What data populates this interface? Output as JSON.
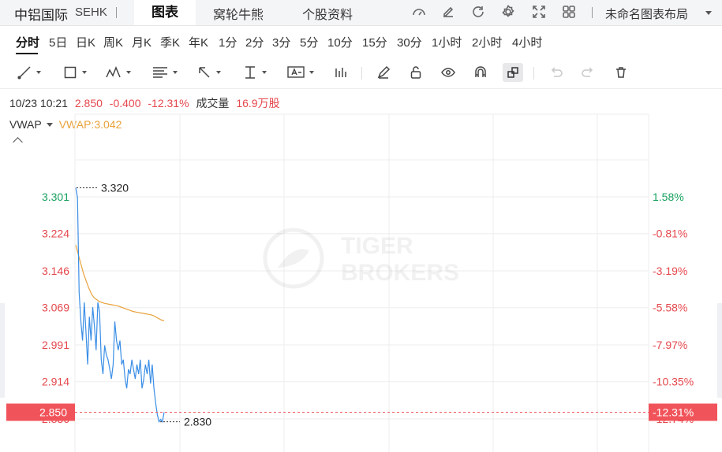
{
  "header": {
    "stock_name": "中铝国际",
    "exchange": "SEHK",
    "active_tab": "图表",
    "tabs": [
      "窝轮牛熊",
      "个股资料"
    ],
    "layout_name": "未命名图表布局"
  },
  "periods": [
    "分时",
    "5日",
    "日K",
    "周K",
    "月K",
    "季K",
    "年K",
    "1分",
    "2分",
    "3分",
    "5分",
    "10分",
    "15分",
    "30分",
    "1小时",
    "2小时",
    "4小时"
  ],
  "active_period": "分时",
  "quote": {
    "datetime": "10/23 10:21",
    "price": "2.850",
    "change": "-0.400",
    "change_pct": "-12.31%",
    "volume_label": "成交量",
    "volume": "16.9万股"
  },
  "indicator": {
    "name": "VWAP",
    "value_text": "VWAP:3.042"
  },
  "colors": {
    "up": "#1aa260",
    "down": "#e5484d",
    "price_line": "#3a8ee6",
    "vwap_line": "#e9a23b",
    "current_box": "#f0545a",
    "grid": "#eeeeee"
  },
  "watermark": {
    "line1": "TIGER",
    "line2": "BROKERS"
  },
  "chart_data": {
    "type": "line",
    "y_axis_left_ticks": [
      "3.301",
      "3.224",
      "3.146",
      "3.069",
      "2.991",
      "2.914",
      "2.836"
    ],
    "y_axis_right_ticks": [
      "1.58%",
      "-0.81%",
      "-3.19%",
      "-5.58%",
      "-7.97%",
      "-10.35%",
      "-12.74%"
    ],
    "ylim": [
      2.836,
      3.301
    ],
    "high_label": "3.320",
    "low_label": "2.830",
    "current_price_label": "2.850",
    "current_pct_label": "-12.31%",
    "current_price": 2.85,
    "series": [
      {
        "name": "VWAP",
        "values": [
          3.2,
          3.18,
          3.16,
          3.14,
          3.125,
          3.11,
          3.098,
          3.09,
          3.086,
          3.082,
          3.08,
          3.078,
          3.077,
          3.076,
          3.075,
          3.074,
          3.073,
          3.071,
          3.069,
          3.067,
          3.065,
          3.063,
          3.061,
          3.06,
          3.059,
          3.058,
          3.057,
          3.056,
          3.055,
          3.054,
          3.052,
          3.049,
          3.046,
          3.043,
          3.042
        ]
      },
      {
        "values": [
          3.32,
          3.3,
          3.1,
          3.04,
          3.0,
          3.08,
          3.02,
          2.95,
          3.05,
          3.0,
          3.07,
          3.03,
          2.98,
          3.08,
          3.06,
          2.96,
          2.93,
          2.99,
          2.97,
          2.96,
          2.94,
          2.92,
          2.95,
          3.04,
          3.0,
          2.98,
          3.0,
          2.95,
          2.96,
          2.92,
          2.9,
          2.94,
          2.93,
          2.96,
          2.94,
          2.92,
          2.95,
          2.93,
          2.96,
          2.9,
          2.92,
          2.95,
          2.93,
          2.96,
          2.91,
          2.95,
          2.9,
          2.87,
          2.845,
          2.83,
          2.835,
          2.83,
          2.85
        ]
      }
    ]
  }
}
